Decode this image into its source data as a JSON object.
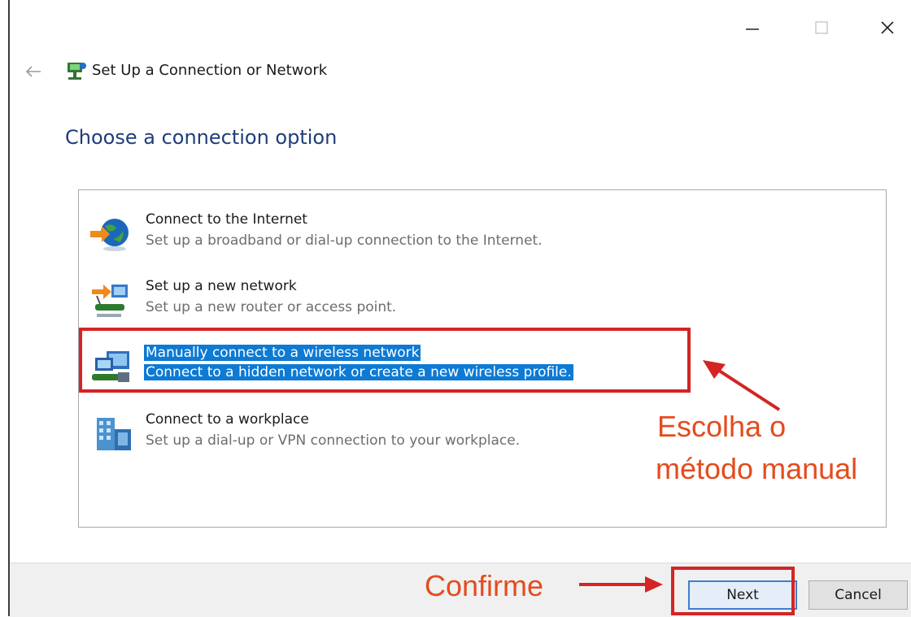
{
  "window": {
    "title": "Set Up a Connection or Network",
    "controls": [
      "minimize",
      "maximize",
      "close"
    ]
  },
  "page": {
    "heading": "Choose a connection option"
  },
  "options": [
    {
      "title": "Connect to the Internet",
      "description": "Set up a broadband or dial-up connection to the Internet.",
      "icon": "globe-icon",
      "selected": false
    },
    {
      "title": "Set up a new network",
      "description": "Set up a new router or access point.",
      "icon": "router-icon",
      "selected": false
    },
    {
      "title": "Manually connect to a wireless network",
      "description": "Connect to a hidden network or create a new wireless profile.",
      "icon": "wireless-computer-icon",
      "selected": true
    },
    {
      "title": "Connect to a workplace",
      "description": "Set up a dial-up or VPN connection to your workplace.",
      "icon": "workplace-icon",
      "selected": false
    }
  ],
  "buttons": {
    "next": "Next",
    "cancel": "Cancel"
  },
  "annotations": {
    "choose_line1": "Escolha o",
    "choose_line2": "método manual",
    "confirm": "Confirme"
  },
  "colors": {
    "selection": "#0d7ad4",
    "heading": "#1e3d7a",
    "annotation": "#e44b1e",
    "highlight_box": "#d42424"
  }
}
